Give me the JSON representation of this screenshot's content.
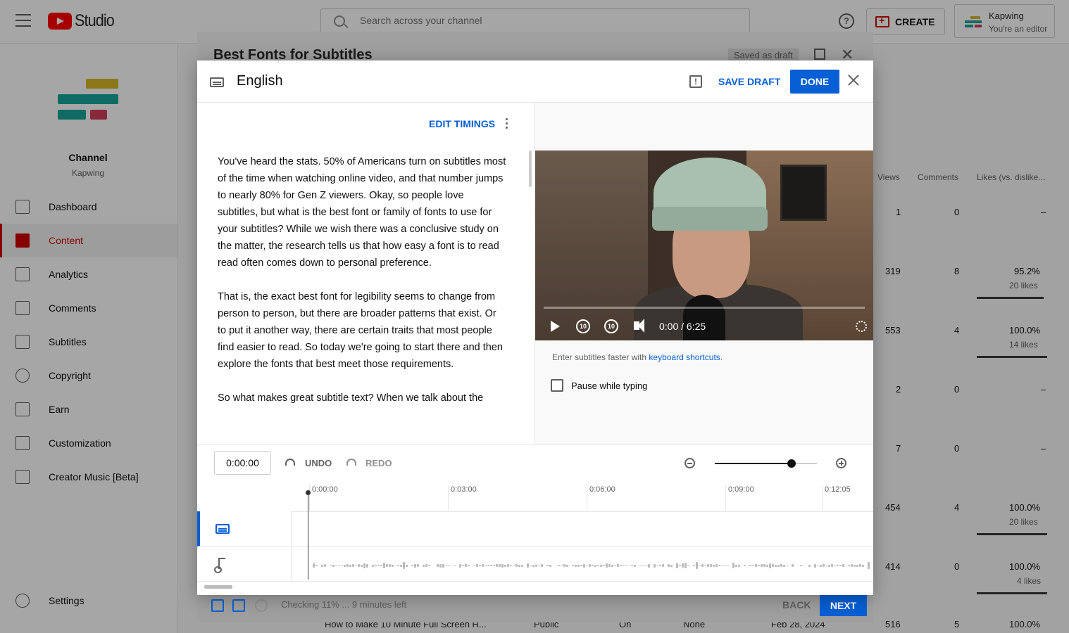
{
  "app": {
    "brand": "Studio",
    "search_placeholder": "Search across your channel",
    "create_label": "CREATE",
    "account_name": "Kapwing",
    "account_role": "You're an editor"
  },
  "sidebar": {
    "channel_title": "Channel",
    "channel_name": "Kapwing",
    "items": [
      {
        "label": "Dashboard"
      },
      {
        "label": "Content"
      },
      {
        "label": "Analytics"
      },
      {
        "label": "Comments"
      },
      {
        "label": "Subtitles"
      },
      {
        "label": "Copyright"
      },
      {
        "label": "Earn"
      },
      {
        "label": "Customization"
      },
      {
        "label": "Creator Music [Beta]"
      },
      {
        "label": "Settings"
      }
    ]
  },
  "content_table": {
    "headers": [
      "Views",
      "Comments",
      "Likes (vs. dislike..."
    ],
    "rows": [
      {
        "views": "1",
        "comments": "0",
        "likes": "–",
        "likes_sub": "",
        "like_ratio": null
      },
      {
        "views": "319",
        "comments": "8",
        "likes": "95.2%",
        "likes_sub": "20 likes",
        "like_ratio": 0.952
      },
      {
        "views": "553",
        "comments": "4",
        "likes": "100.0%",
        "likes_sub": "14 likes",
        "like_ratio": 1.0
      },
      {
        "views": "2",
        "comments": "0",
        "likes": "–",
        "likes_sub": "",
        "like_ratio": null
      },
      {
        "views": "7",
        "comments": "0",
        "likes": "–",
        "likes_sub": "",
        "like_ratio": null
      },
      {
        "views": "454",
        "comments": "4",
        "likes": "100.0%",
        "likes_sub": "20 likes",
        "like_ratio": 1.0
      },
      {
        "views": "414",
        "comments": "0",
        "likes": "100.0%",
        "likes_sub": "4 likes",
        "like_ratio": 1.0
      }
    ],
    "partial_row": {
      "title": "How to Make 10 Minute Full Screen H...",
      "visibility": "Public",
      "restrictions": "On",
      "monetization": "None",
      "date": "Feb 28, 2024",
      "views": "516",
      "comments": "5",
      "likes": "100.0%"
    }
  },
  "upload_dialog": {
    "title": "Best Fonts for Subtitles",
    "saved_status": "Saved as draft",
    "checking_status": "Checking 11% ... 9 minutes left",
    "back_label": "BACK",
    "next_label": "NEXT"
  },
  "editor": {
    "language": "English",
    "save_draft_label": "SAVE DRAFT",
    "done_label": "DONE",
    "edit_timings_label": "EDIT TIMINGS",
    "transcript": [
      "You've heard the stats. 50% of Americans turn on subtitles most of the time when watching online video, and that number jumps to nearly 80% for Gen Z viewers. Okay, so people love subtitles, but what is the best font or family of fonts to use for your subtitles? While we wish there was a conclusive study on the matter, the research tells us that how easy a font is to read read often comes down to personal preference.",
      "That is, the exact best font for legibility seems to change from person to person, but there are broader patterns that exist. Or to put it another way, there are certain traits that most people find easier to read. So today we're going to start there and then explore the fonts that best meet those requirements.",
      "So what makes great subtitle text? When we talk about the"
    ],
    "player": {
      "time_display": "0:00 / 6:25",
      "progress": 0.0,
      "rewind_label": "10",
      "forward_label": "10"
    },
    "hint_text": "Enter subtitles faster with ",
    "hint_link": "keyboard shortcuts",
    "hint_end": ".",
    "pause_while_typing_label": "Pause while typing",
    "pause_while_typing_checked": false,
    "timeline": {
      "current_time": "0:00:00",
      "undo_label": "UNDO",
      "redo_label": "REDO",
      "zoom_level": 0.75,
      "ticks": [
        "0:00:00",
        "0:03:00",
        "0:06:00",
        "0:09:00",
        "0:12:05"
      ]
    }
  },
  "colors": {
    "accent": "#065fd4",
    "brand_red": "#ff0000",
    "active_nav": "#cc0000"
  }
}
